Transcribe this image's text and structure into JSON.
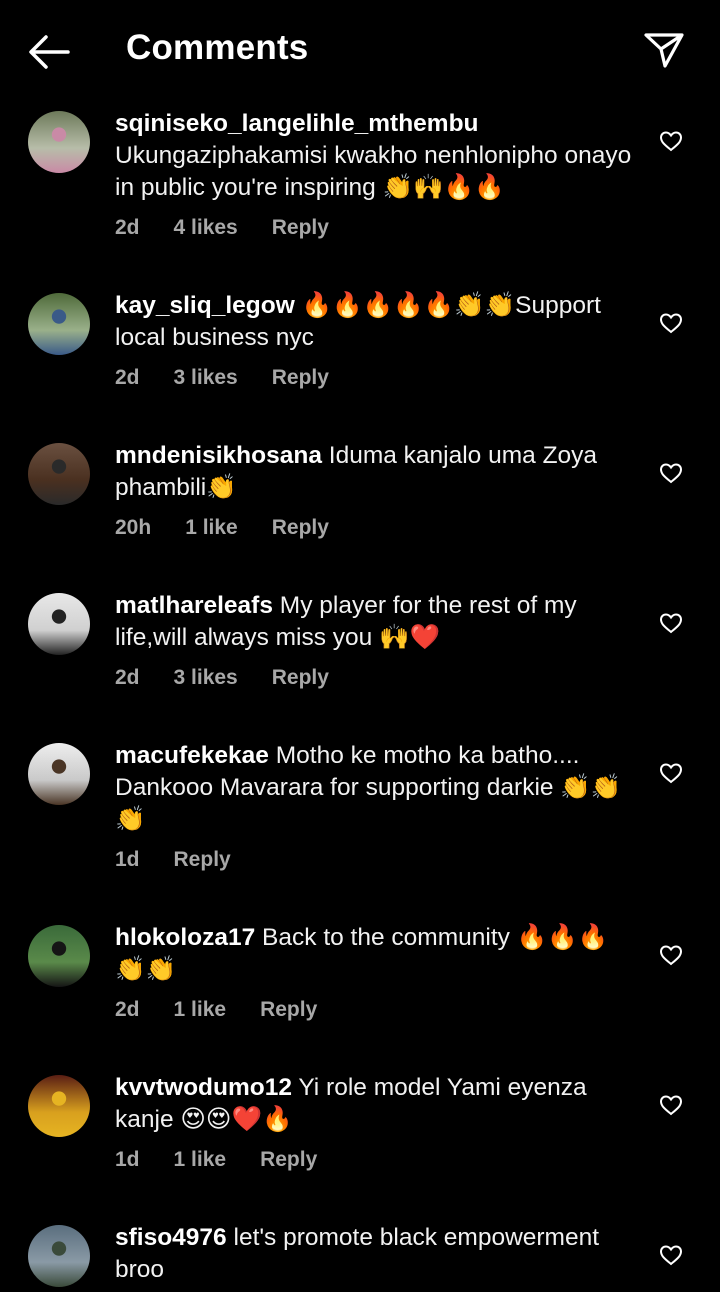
{
  "header": {
    "title": "Comments"
  },
  "comments": [
    {
      "user": "sqiniseko_langelihle_mthembu",
      "text": "Ukungaziphakamisi kwakho nenhlonipho onayo in public you're inspiring 👏🙌🔥🔥",
      "time": "2d",
      "likes": "4 likes",
      "reply": "Reply"
    },
    {
      "user": "kay_sliq_legow",
      "text": "🔥🔥🔥🔥🔥👏👏Support local business nyc",
      "time": "2d",
      "likes": "3 likes",
      "reply": "Reply"
    },
    {
      "user": "mndenisikhosana",
      "text": "Iduma kanjalo uma Zoya phambili👏",
      "time": "20h",
      "likes": "1 like",
      "reply": "Reply"
    },
    {
      "user": "matlhareleafs",
      "text": "My player for the rest of my life,will always miss you 🙌❤️",
      "time": "2d",
      "likes": "3 likes",
      "reply": "Reply"
    },
    {
      "user": "macufekekae",
      "text": "Motho ke motho ka batho.... Dankooo Mavarara for supporting darkie 👏👏👏",
      "time": "1d",
      "likes": "",
      "reply": "Reply"
    },
    {
      "user": "hlokoloza17",
      "text": "Back to the community 🔥🔥🔥👏👏",
      "time": "2d",
      "likes": "1 like",
      "reply": "Reply"
    },
    {
      "user": "kvvtwodumo12",
      "text": "Yi role model Yami eyenza kanje 😍😍❤️🔥",
      "time": "1d",
      "likes": "1 like",
      "reply": "Reply"
    },
    {
      "user": "sfiso4976",
      "text": "let's promote black empowerment broo",
      "time": "",
      "likes": "",
      "reply": ""
    }
  ],
  "colors": {
    "background": "#000000",
    "text": "#ffffff",
    "meta": "#a8a8a8"
  },
  "icons": {
    "back": "arrow-left-icon",
    "share": "paper-plane-icon",
    "like": "heart-outline-icon"
  }
}
